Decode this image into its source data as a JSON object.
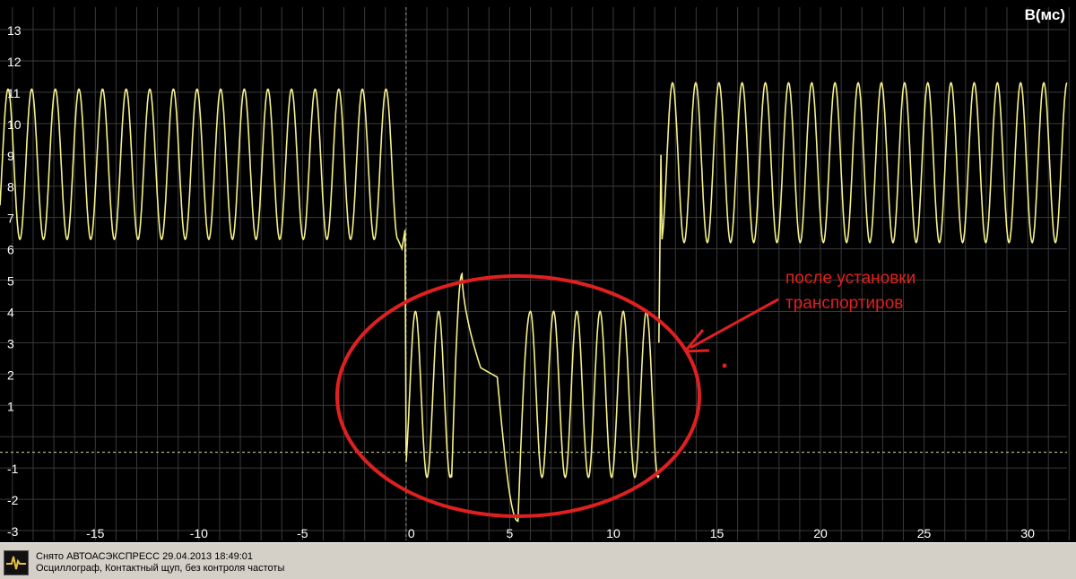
{
  "chart_data": {
    "type": "line",
    "title": "",
    "ylabel": "В(мс)",
    "xlabel": "",
    "xlim": [
      -19.6,
      31.9
    ],
    "ylim": [
      -3.2,
      13.6
    ],
    "x_ticks": [
      -15,
      -10,
      -5,
      0,
      5,
      10,
      15,
      20,
      25,
      30
    ],
    "y_ticks": [
      13,
      12,
      11,
      10,
      9,
      8,
      7,
      6,
      5,
      4,
      3,
      2,
      1,
      -1,
      -2,
      -3
    ],
    "grid": true,
    "reference_lines": {
      "horizontal_dashed_y": -0.5,
      "vertical_dashed_x": 0
    },
    "series": [
      {
        "color": "#f5f08a",
        "segments": [
          {
            "x_range": [
              -19.6,
              -0.4
            ],
            "type": "sinusoid",
            "low": 6.3,
            "high": 11.1,
            "period_ms": 1.14
          },
          {
            "x_range": [
              0,
              12.2
            ],
            "type": "sinusoid",
            "low": -1.3,
            "high": 4.0,
            "period_ms": 1.12,
            "disturbance": {
              "peak_x": 2.7,
              "peak_y": 5.2,
              "trough_x": 5.4,
              "trough_y": -2.7
            }
          },
          {
            "x_range": [
              12.3,
              31.9
            ],
            "type": "sinusoid",
            "low": 6.2,
            "high": 11.3,
            "period_ms": 1.12,
            "spike": {
              "x": 12.3,
              "y": 9.0
            }
          }
        ]
      }
    ],
    "annotations": [
      {
        "text": "после установки",
        "color": "#e02020"
      },
      {
        "text": "транспортиров",
        "color": "#e02020"
      }
    ],
    "highlight": {
      "shape": "ellipse",
      "color": "#e02020"
    }
  },
  "status": {
    "line1": "Снято АВТОАСЭКСПРЕСС  29.04.2013 18:49:01",
    "line2": "Осциллограф, Контактный щуп, без контроля частоты"
  },
  "colors": {
    "background": "#000000",
    "grid": "#3a3a3a",
    "signal": "#f5f08a",
    "axis_text": "#ffffff",
    "annotation": "#e02020",
    "statusbar": "#d4d0c8"
  }
}
